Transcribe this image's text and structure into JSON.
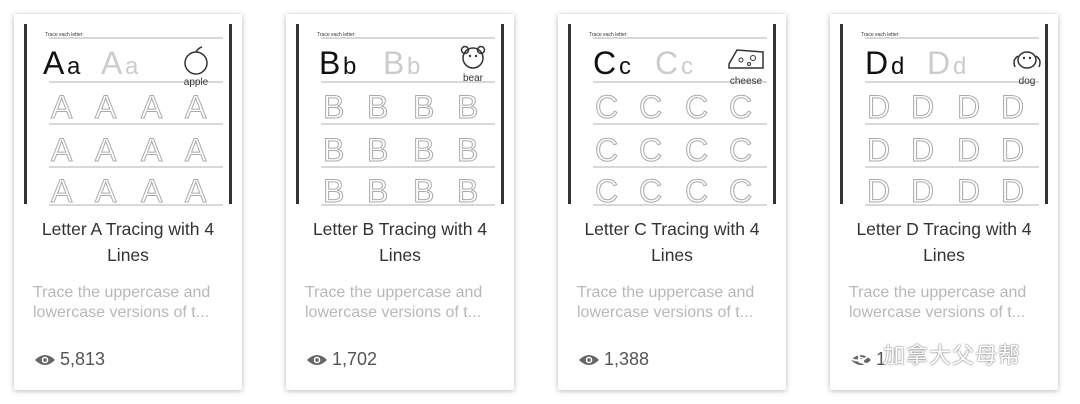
{
  "cards": [
    {
      "letter_upper": "A",
      "letter_lower": "a",
      "instruction": "Trace each letter:",
      "picture_word": "apple",
      "picture_icon": "apple-icon",
      "title": "Letter A Tracing with 4 Lines",
      "description": "Trace the uppercase and lowercase versions of t...",
      "views": "5,813"
    },
    {
      "letter_upper": "B",
      "letter_lower": "b",
      "instruction": "Trace each letter:",
      "picture_word": "bear",
      "picture_icon": "bear-icon",
      "title": "Letter B Tracing with 4 Lines",
      "description": "Trace the uppercase and lowercase versions of t...",
      "views": "1,702"
    },
    {
      "letter_upper": "C",
      "letter_lower": "c",
      "instruction": "Trace each letter:",
      "picture_word": "cheese",
      "picture_icon": "cheese-icon",
      "title": "Letter C Tracing with 4 Lines",
      "description": "Trace the uppercase and lowercase versions of t...",
      "views": "1,388"
    },
    {
      "letter_upper": "D",
      "letter_lower": "d",
      "instruction": "Trace each letter:",
      "picture_word": "dog",
      "picture_icon": "dog-icon",
      "title": "Letter D Tracing with 4 Lines",
      "description": "Trace the uppercase and lowercase versions of t...",
      "views": "1"
    }
  ],
  "watermark": {
    "text": "加拿大父母帮",
    "icon": "wechat-icon"
  }
}
